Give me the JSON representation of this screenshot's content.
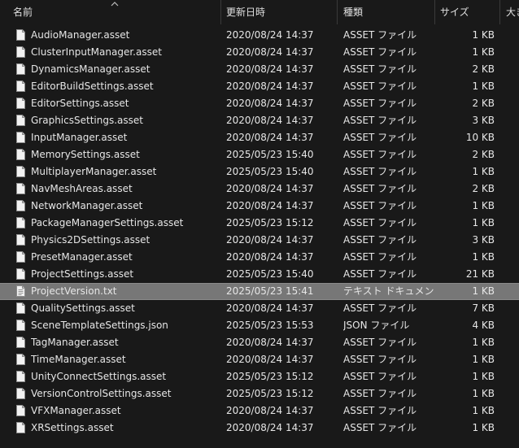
{
  "columns": {
    "name": "名前",
    "date": "更新日時",
    "type": "種類",
    "size": "サイズ",
    "extra": "大き"
  },
  "files": [
    {
      "name": "AudioManager.asset",
      "date": "2020/08/24 14:37",
      "type": "ASSET ファイル",
      "size": "1 KB"
    },
    {
      "name": "ClusterInputManager.asset",
      "date": "2020/08/24 14:37",
      "type": "ASSET ファイル",
      "size": "1 KB"
    },
    {
      "name": "DynamicsManager.asset",
      "date": "2020/08/24 14:37",
      "type": "ASSET ファイル",
      "size": "2 KB"
    },
    {
      "name": "EditorBuildSettings.asset",
      "date": "2020/08/24 14:37",
      "type": "ASSET ファイル",
      "size": "1 KB"
    },
    {
      "name": "EditorSettings.asset",
      "date": "2020/08/24 14:37",
      "type": "ASSET ファイル",
      "size": "2 KB"
    },
    {
      "name": "GraphicsSettings.asset",
      "date": "2020/08/24 14:37",
      "type": "ASSET ファイル",
      "size": "3 KB"
    },
    {
      "name": "InputManager.asset",
      "date": "2020/08/24 14:37",
      "type": "ASSET ファイル",
      "size": "10 KB"
    },
    {
      "name": "MemorySettings.asset",
      "date": "2025/05/23 15:40",
      "type": "ASSET ファイル",
      "size": "2 KB"
    },
    {
      "name": "MultiplayerManager.asset",
      "date": "2025/05/23 15:40",
      "type": "ASSET ファイル",
      "size": "1 KB"
    },
    {
      "name": "NavMeshAreas.asset",
      "date": "2020/08/24 14:37",
      "type": "ASSET ファイル",
      "size": "2 KB"
    },
    {
      "name": "NetworkManager.asset",
      "date": "2020/08/24 14:37",
      "type": "ASSET ファイル",
      "size": "1 KB"
    },
    {
      "name": "PackageManagerSettings.asset",
      "date": "2025/05/23 15:12",
      "type": "ASSET ファイル",
      "size": "1 KB"
    },
    {
      "name": "Physics2DSettings.asset",
      "date": "2020/08/24 14:37",
      "type": "ASSET ファイル",
      "size": "3 KB"
    },
    {
      "name": "PresetManager.asset",
      "date": "2020/08/24 14:37",
      "type": "ASSET ファイル",
      "size": "1 KB"
    },
    {
      "name": "ProjectSettings.asset",
      "date": "2025/05/23 15:40",
      "type": "ASSET ファイル",
      "size": "21 KB"
    },
    {
      "name": "ProjectVersion.txt",
      "date": "2025/05/23 15:41",
      "type": "テキスト ドキュメント",
      "size": "1 KB",
      "selected": true
    },
    {
      "name": "QualitySettings.asset",
      "date": "2020/08/24 14:37",
      "type": "ASSET ファイル",
      "size": "7 KB"
    },
    {
      "name": "SceneTemplateSettings.json",
      "date": "2025/05/23 15:53",
      "type": "JSON ファイル",
      "size": "4 KB"
    },
    {
      "name": "TagManager.asset",
      "date": "2020/08/24 14:37",
      "type": "ASSET ファイル",
      "size": "1 KB"
    },
    {
      "name": "TimeManager.asset",
      "date": "2020/08/24 14:37",
      "type": "ASSET ファイル",
      "size": "1 KB"
    },
    {
      "name": "UnityConnectSettings.asset",
      "date": "2025/05/23 15:12",
      "type": "ASSET ファイル",
      "size": "1 KB"
    },
    {
      "name": "VersionControlSettings.asset",
      "date": "2025/05/23 15:12",
      "type": "ASSET ファイル",
      "size": "1 KB"
    },
    {
      "name": "VFXManager.asset",
      "date": "2020/08/24 14:37",
      "type": "ASSET ファイル",
      "size": "1 KB"
    },
    {
      "name": "XRSettings.asset",
      "date": "2020/08/24 14:37",
      "type": "ASSET ファイル",
      "size": "1 KB"
    }
  ],
  "icons": {
    "sort": "chevron-up-icon",
    "file": "file-icon",
    "text_file": "text-file-icon"
  },
  "colors": {
    "background": "#191919",
    "text": "#e6e6e6",
    "selection": "#777777"
  }
}
